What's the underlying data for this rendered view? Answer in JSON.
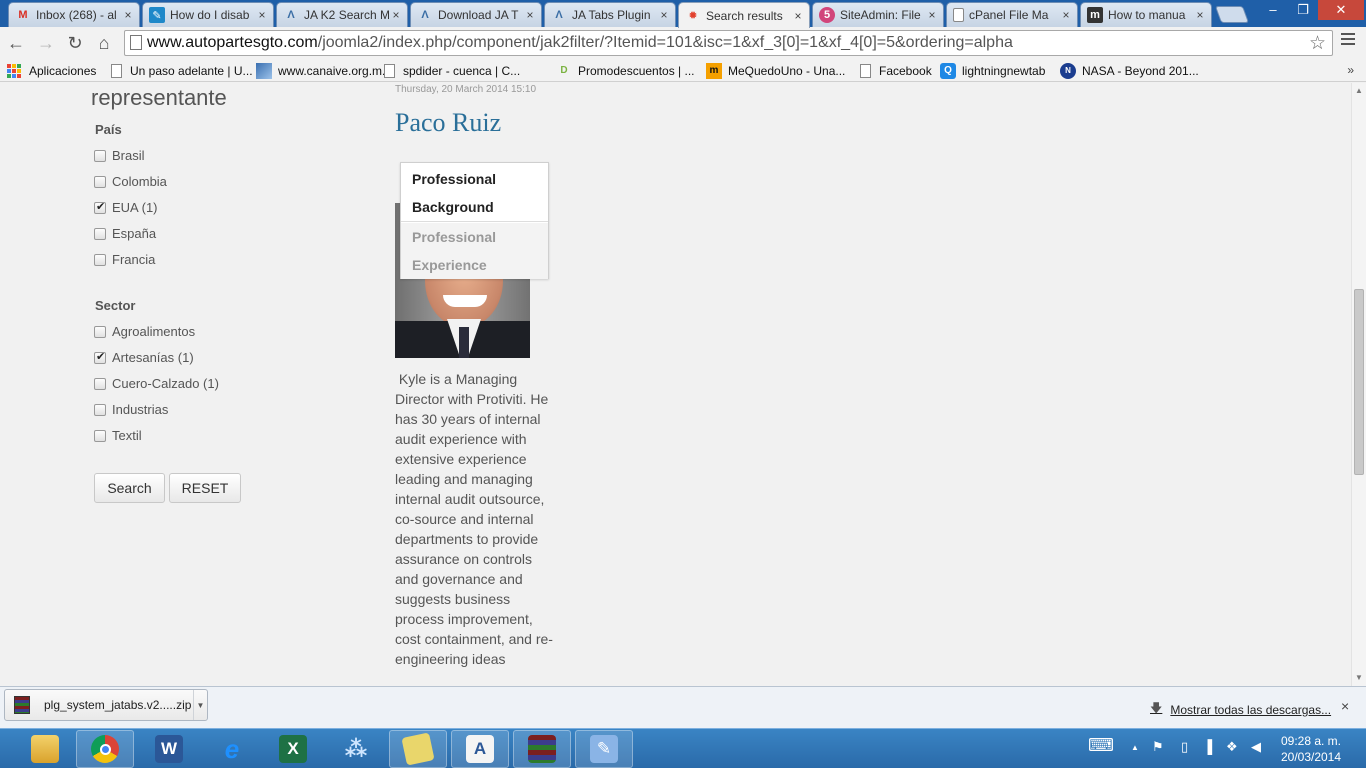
{
  "browser": {
    "tabs": [
      {
        "title": "Inbox (268) - al",
        "icon": "gmail-icon",
        "color": "#d93025",
        "glyph": "M"
      },
      {
        "title": "How do I disab",
        "icon": "pencil-icon",
        "color": "#1e88c9",
        "glyph": "✎"
      },
      {
        "title": "JA K2 Search M",
        "icon": "ja-icon",
        "color": "#3a6ea5",
        "glyph": "Λ"
      },
      {
        "title": "Download JA T",
        "icon": "ja-icon",
        "color": "#3a6ea5",
        "glyph": "Λ"
      },
      {
        "title": "JA Tabs Plugin",
        "icon": "ja-icon",
        "color": "#3a6ea5",
        "glyph": "Λ"
      },
      {
        "title": "Search results",
        "icon": "joomla-icon",
        "color": "#e2402d",
        "glyph": "✹",
        "active": true
      },
      {
        "title": "SiteAdmin: File",
        "icon": "siteadmin-icon",
        "color": "#d1457b",
        "glyph": "5"
      },
      {
        "title": "cPanel File Ma",
        "icon": "page-icon",
        "color": "#ffffff",
        "glyph": ""
      },
      {
        "title": "How to manua",
        "icon": "monitor-icon",
        "color": "#333333",
        "glyph": "m"
      }
    ],
    "close_glyph": "×",
    "window_controls": {
      "minimize": "–",
      "restore": "❐",
      "close": "✕"
    },
    "nav": {
      "back": "←",
      "forward": "→",
      "reload": "↻",
      "home": "⌂"
    },
    "url": {
      "host": "www.autopartesgto.com",
      "path": "/joomla2/index.php/component/jak2filter/?Itemid=101&isc=1&xf_3[0]=1&xf_4[0]=5&ordering=alpha"
    },
    "star_glyph": "☆",
    "more_glyph": "»",
    "bookmarks": [
      {
        "label": "Aplicaciones",
        "icon": "apps-icon"
      },
      {
        "label": "Un paso adelante | U...",
        "icon": "page-icon"
      },
      {
        "label": "www.canaive.org.m...",
        "icon": "canaive-icon",
        "color": "#3a6fb0"
      },
      {
        "label": "spdider - cuenca | C...",
        "icon": "page-icon"
      },
      {
        "label": "Promodescuentos | ...",
        "icon": "promo-icon",
        "color": "#7cb342",
        "glyph": "D"
      },
      {
        "label": "MeQuedoUno - Una...",
        "icon": "mequedouno-icon",
        "color": "#f5a000",
        "glyph": "m"
      },
      {
        "label": "Facebook",
        "icon": "page-icon"
      },
      {
        "label": "lightningnewtab",
        "icon": "lightning-icon",
        "color": "#1e88e5",
        "glyph": "Q"
      },
      {
        "label": "NASA - Beyond 201...",
        "icon": "nasa-icon",
        "color": "#1b3d8f",
        "glyph": "N"
      }
    ],
    "app_colors": [
      "#ea4335",
      "#fbbc05",
      "#34a853",
      "#4285f4",
      "#ea4335",
      "#fbbc05",
      "#34a853",
      "#4285f4",
      "#ea4335"
    ]
  },
  "filter": {
    "heading": "representante",
    "groups": [
      {
        "label": "País",
        "options": [
          {
            "label": "Brasil",
            "checked": false
          },
          {
            "label": "Colombia",
            "checked": false
          },
          {
            "label": "EUA (1)",
            "checked": true
          },
          {
            "label": "España",
            "checked": false
          },
          {
            "label": "Francia",
            "checked": false
          }
        ]
      },
      {
        "label": "Sector",
        "options": [
          {
            "label": "Agroalimentos",
            "checked": false
          },
          {
            "label": "Artesanías (1)",
            "checked": true
          },
          {
            "label": "Cuero-Calzado (1)",
            "checked": false
          },
          {
            "label": "Industrias",
            "checked": false
          },
          {
            "label": "Textil",
            "checked": false
          }
        ]
      }
    ],
    "search_label": "Search",
    "reset_label": "RESET"
  },
  "article": {
    "date": "Thursday, 20 March 2014 15:10",
    "title": "Paco Ruiz",
    "tabs": [
      "Professional Background",
      "Professional Experience"
    ],
    "bio": " Kyle is a Managing Director with Protiviti. He has 30 years of internal audit experience with extensive experience leading and managing internal audit outsource, co-source and internal departments to provide assurance on controls and governance and suggests business process improvement, cost containment, and re-engineering ideas"
  },
  "downloads": {
    "file_name": "plg_system_jatabs.v2.....zip",
    "show_all": "Mostrar todas las descargas...",
    "close_glyph": "×"
  },
  "taskbar": {
    "apps": [
      {
        "name": "file-explorer-icon",
        "color": "#e8b93a",
        "glyph": ""
      },
      {
        "name": "chrome-icon",
        "color": "#db4437",
        "glyph": "●",
        "active": true
      },
      {
        "name": "word-icon",
        "color": "#2b5797",
        "glyph": "W"
      },
      {
        "name": "internet-explorer-icon",
        "color": "#1e90ff",
        "glyph": "e"
      },
      {
        "name": "excel-icon",
        "color": "#1e7145",
        "glyph": "X"
      },
      {
        "name": "network-icon",
        "color": "#5aa0d8",
        "glyph": "⁂"
      },
      {
        "name": "sticky-notes-icon",
        "color": "#e9d66b",
        "glyph": "",
        "boxed": true
      },
      {
        "name": "wordpad-icon",
        "color": "#6c9bd1",
        "glyph": "A",
        "boxed": true
      },
      {
        "name": "winrar-icon",
        "color": "#7a2a7a",
        "glyph": "≡",
        "boxed": true
      },
      {
        "name": "notepad-icon",
        "color": "#8ab4e6",
        "glyph": "✎",
        "boxed": true
      }
    ],
    "tray": {
      "keyboard": "⌨",
      "up": "▲",
      "flag": "⚑",
      "battery": "▯",
      "signal": "▐",
      "dropbox": "❖",
      "volume": "◀"
    },
    "time": "09:28 a. m.",
    "date": "20/03/2014"
  }
}
